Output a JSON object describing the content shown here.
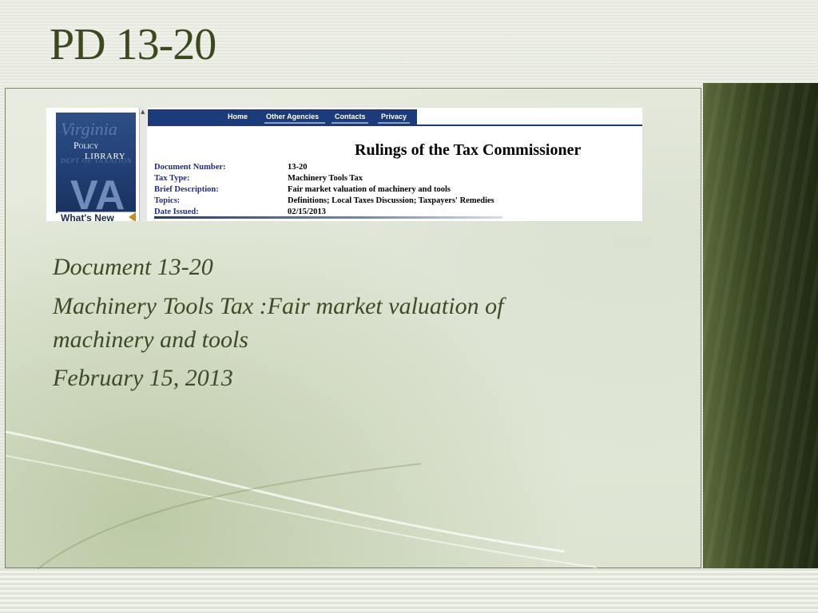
{
  "slide": {
    "title": "PD 13-20",
    "body": {
      "line1": "Document 13-20",
      "line2": "Machinery Tools Tax :Fair market valuation of",
      "line3": "machinery and tools",
      "line4": "February 15, 2013"
    }
  },
  "screenshot": {
    "logo": {
      "word1": "Virginia",
      "policy": "Policy",
      "library": "LIBRARY",
      "dept": "DEPT OF TAXATION",
      "mark": "VA",
      "whats_new": "What's New"
    },
    "nav": {
      "home": "Home",
      "other_agencies": "Other Agencies",
      "contacts": "Contacts",
      "privacy": "Privacy"
    },
    "page_title": "Rulings of the Tax Commissioner",
    "fields": [
      {
        "label": "Document Number:",
        "value": "13-20"
      },
      {
        "label": "Tax Type:",
        "value": "Machinery Tools Tax"
      },
      {
        "label": "Brief Description:",
        "value": "Fair market valuation of machinery and tools"
      },
      {
        "label": "Topics:",
        "value": "Definitions; Local Taxes Discussion; Taxpayers' Remedies"
      },
      {
        "label": "Date Issued:",
        "value": "02/15/2013"
      }
    ]
  },
  "colors": {
    "title_green": "#3a4a1e",
    "body_text": "#3e4a26",
    "nav_blue": "#1c3b7a",
    "label_blue": "#1c2e8a",
    "band_dark": "#1f2a12"
  },
  "icons": {
    "whats_new_arrow": "left-triangle-icon",
    "scroll_up": "scroll-up-arrow-icon"
  }
}
